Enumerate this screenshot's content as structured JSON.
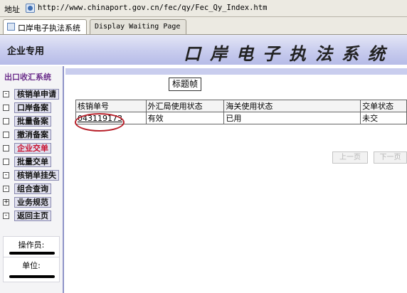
{
  "address_bar": {
    "label": "地址",
    "url": "http://www.chinaport.gov.cn/fec/qy/Fec_Qy_Index.htm"
  },
  "tabs": [
    {
      "label": "口岸电子执法系统"
    },
    {
      "label": "Display Waiting Page"
    }
  ],
  "header": {
    "left_label": "企业专用",
    "title": "口岸电子执法系统"
  },
  "sidebar": {
    "title": "出口收汇系统",
    "items": [
      {
        "label": "核销单申请",
        "box": "-"
      },
      {
        "label": "口岸备案",
        "box": ""
      },
      {
        "label": "批量备案",
        "box": ""
      },
      {
        "label": "撤消备案",
        "box": ""
      },
      {
        "label": "企业交单",
        "box": "",
        "active": true
      },
      {
        "label": "批量交单",
        "box": ""
      },
      {
        "label": "核销单挂失",
        "box": "-"
      },
      {
        "label": "组合查询",
        "box": "-"
      },
      {
        "label": "业务规范",
        "box": "+"
      },
      {
        "label": "返回主页",
        "box": "-"
      }
    ],
    "operator_label": "操作员:",
    "unit_label": "单位:"
  },
  "content": {
    "frame_title": "标题帧",
    "table": {
      "headers": [
        "核销单号",
        "外汇局使用状态",
        "海关使用状态",
        "交单状态"
      ],
      "rows": [
        [
          "043119173",
          "有效",
          "已用",
          "未交"
        ]
      ]
    },
    "prev_page": "上一页",
    "next_page": "下一页"
  },
  "colors": {
    "header_band": "#c9cdee",
    "sidebar_title": "#6b2d8a",
    "active_item": "#c8102e",
    "annotation_circle": "#b8202a"
  }
}
